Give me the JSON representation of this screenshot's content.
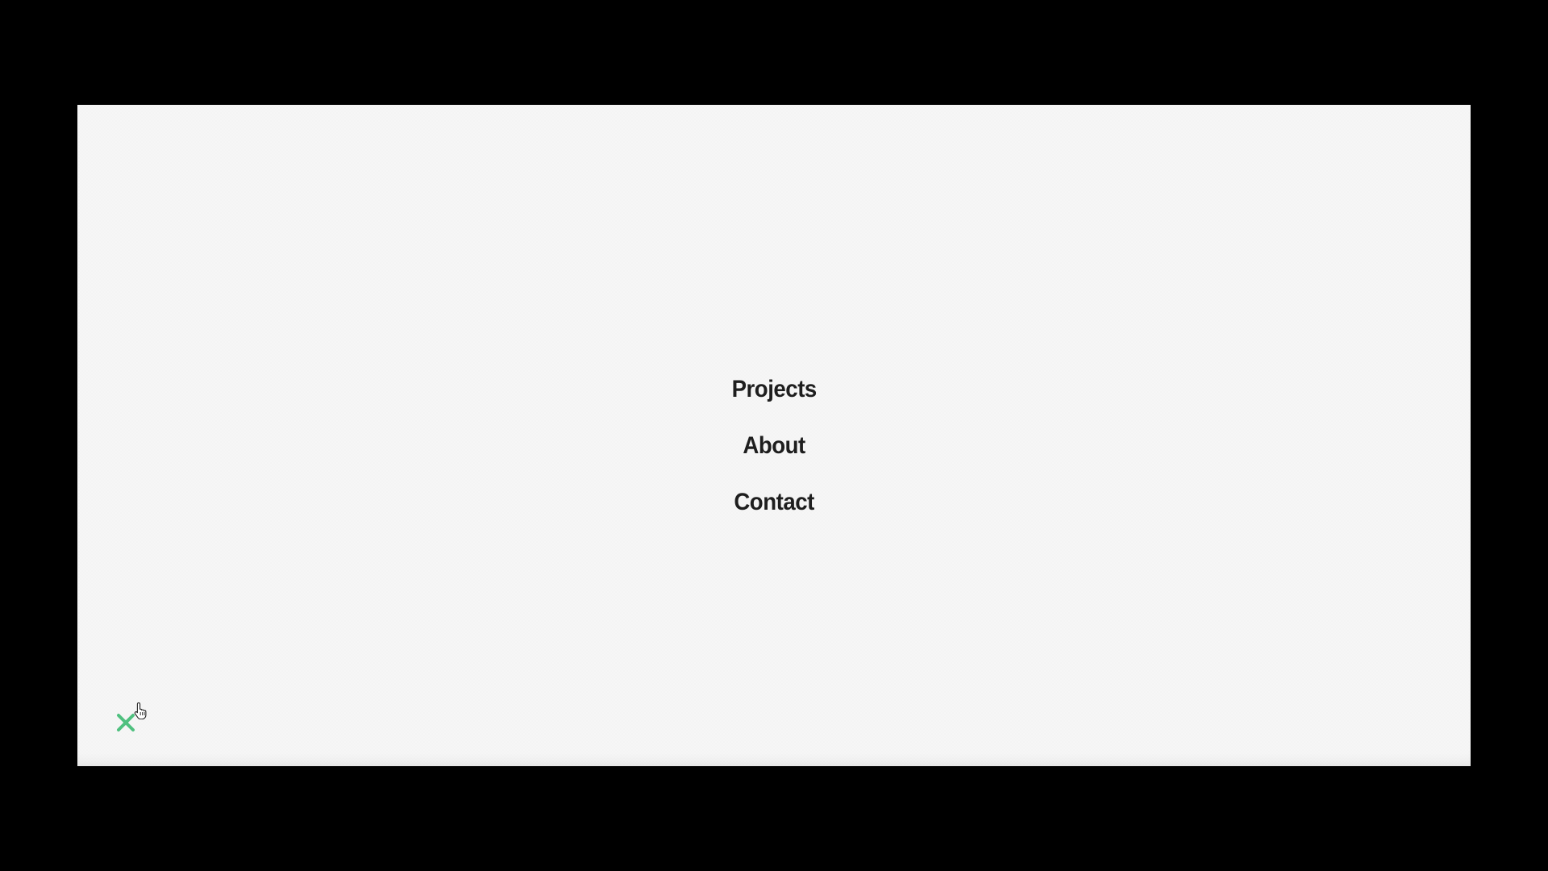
{
  "nav": {
    "items": [
      {
        "label": "Projects"
      },
      {
        "label": "About"
      },
      {
        "label": "Contact"
      }
    ]
  },
  "close_button": {
    "icon": "close-icon",
    "color": "#4fc07f"
  },
  "colors": {
    "background": "#f6f6f6",
    "letterbox": "#000000",
    "text": "#1e1e1e"
  }
}
